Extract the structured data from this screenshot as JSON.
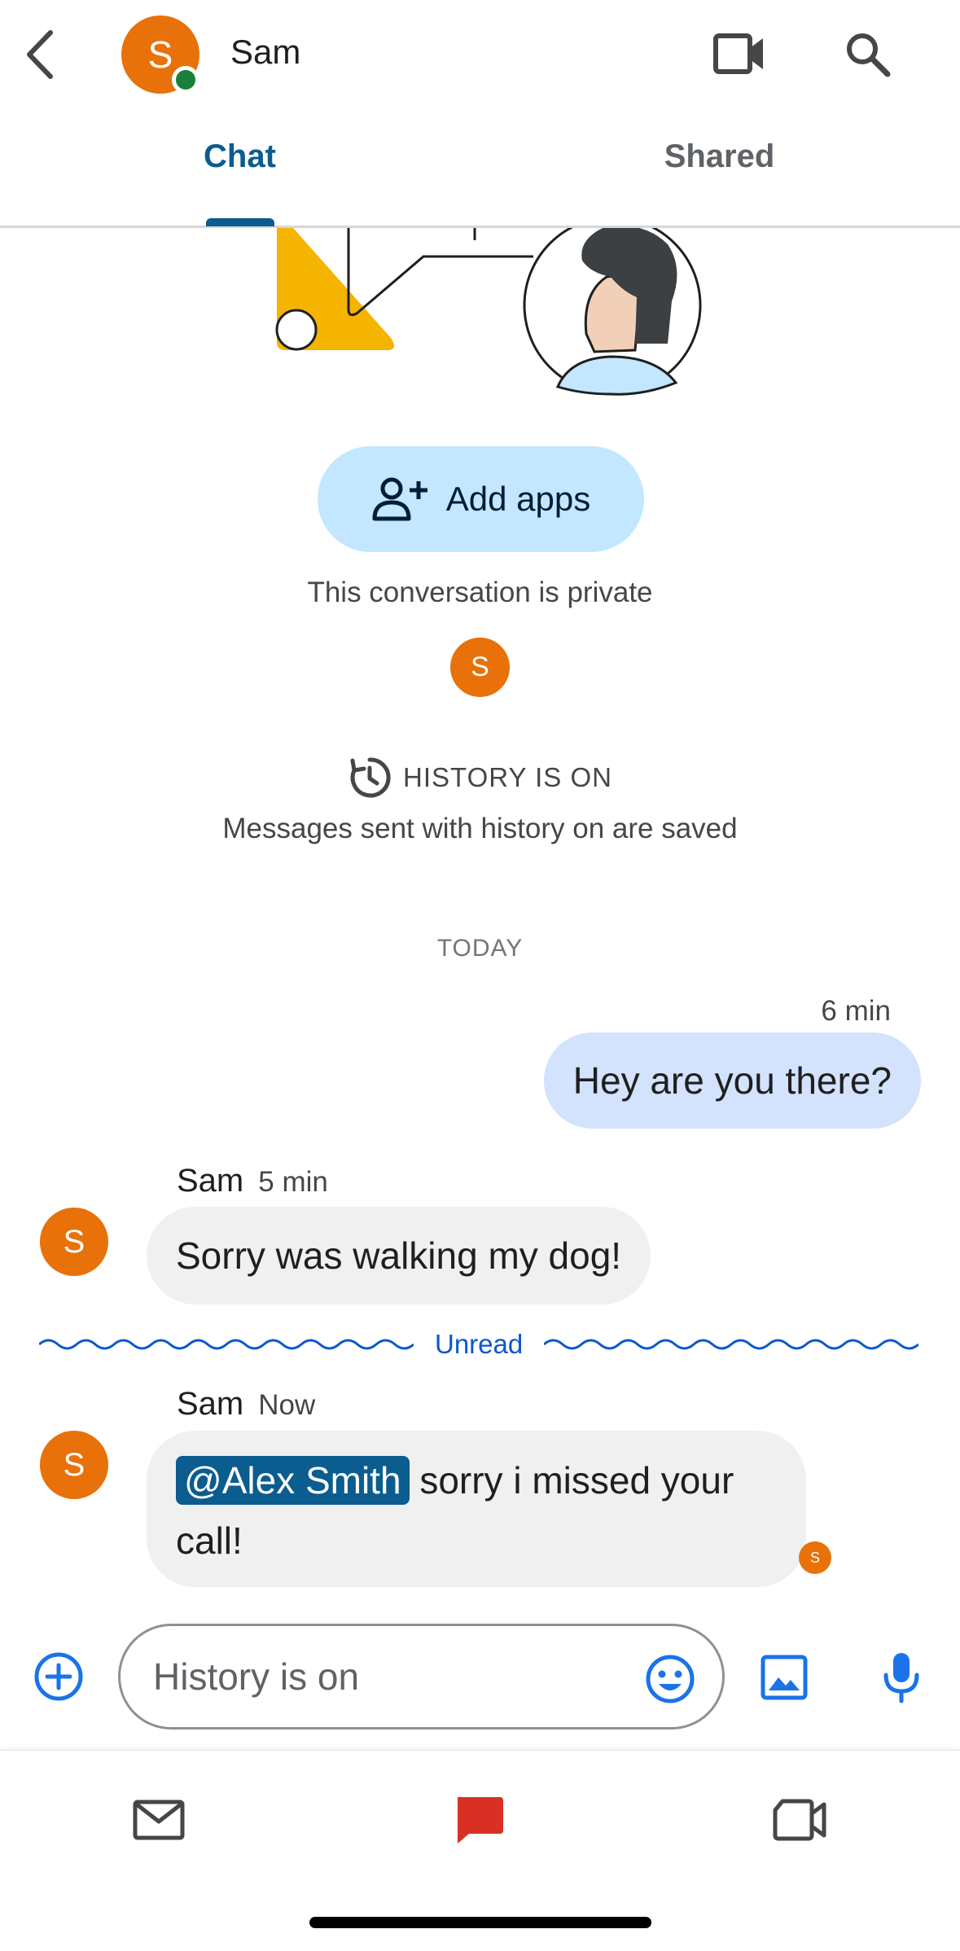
{
  "header": {
    "contact_name": "Sam",
    "avatar_initial": "S",
    "tabs": [
      {
        "label": "Chat",
        "active": true
      },
      {
        "label": "Shared",
        "active": false
      }
    ]
  },
  "intro": {
    "add_apps_label": "Add apps",
    "private_text": "This conversation is private",
    "member_initial": "S",
    "history_label": "HISTORY IS ON",
    "history_description": "Messages sent with history on are saved"
  },
  "messages": {
    "day_divider": "TODAY",
    "sent": {
      "time": "6 min",
      "text": "Hey are you there?"
    },
    "received_1": {
      "sender": "Sam",
      "time": "5 min",
      "initial": "S",
      "text": "Sorry was walking my dog!"
    },
    "unread_label": "Unread",
    "received_2": {
      "sender": "Sam",
      "time": "Now",
      "initial": "S",
      "mention": "@Alex Smith",
      "text": " sorry i missed your call!",
      "read_by_initial": "S"
    }
  },
  "composer": {
    "placeholder": "History is on"
  },
  "colors": {
    "accent": "#0b5c8f",
    "avatar": "#e8710a",
    "presence": "#188038",
    "sent_bubble": "#d3e3fd",
    "received_bubble": "#f0f0f0",
    "add_apps_bg": "#c2e7ff",
    "chat_nav_active": "#d93025",
    "icon_blue": "#1a73e8"
  },
  "icons": {
    "back": "chevron-left-icon",
    "video": "video-camera-icon",
    "search": "search-icon",
    "add_person": "person-add-icon",
    "history": "history-clock-icon",
    "add": "add-circle-icon",
    "emoji": "emoji-icon",
    "image": "image-icon",
    "mic": "microphone-icon",
    "mail": "mail-icon",
    "chat": "chat-icon",
    "meet": "meet-icon"
  }
}
